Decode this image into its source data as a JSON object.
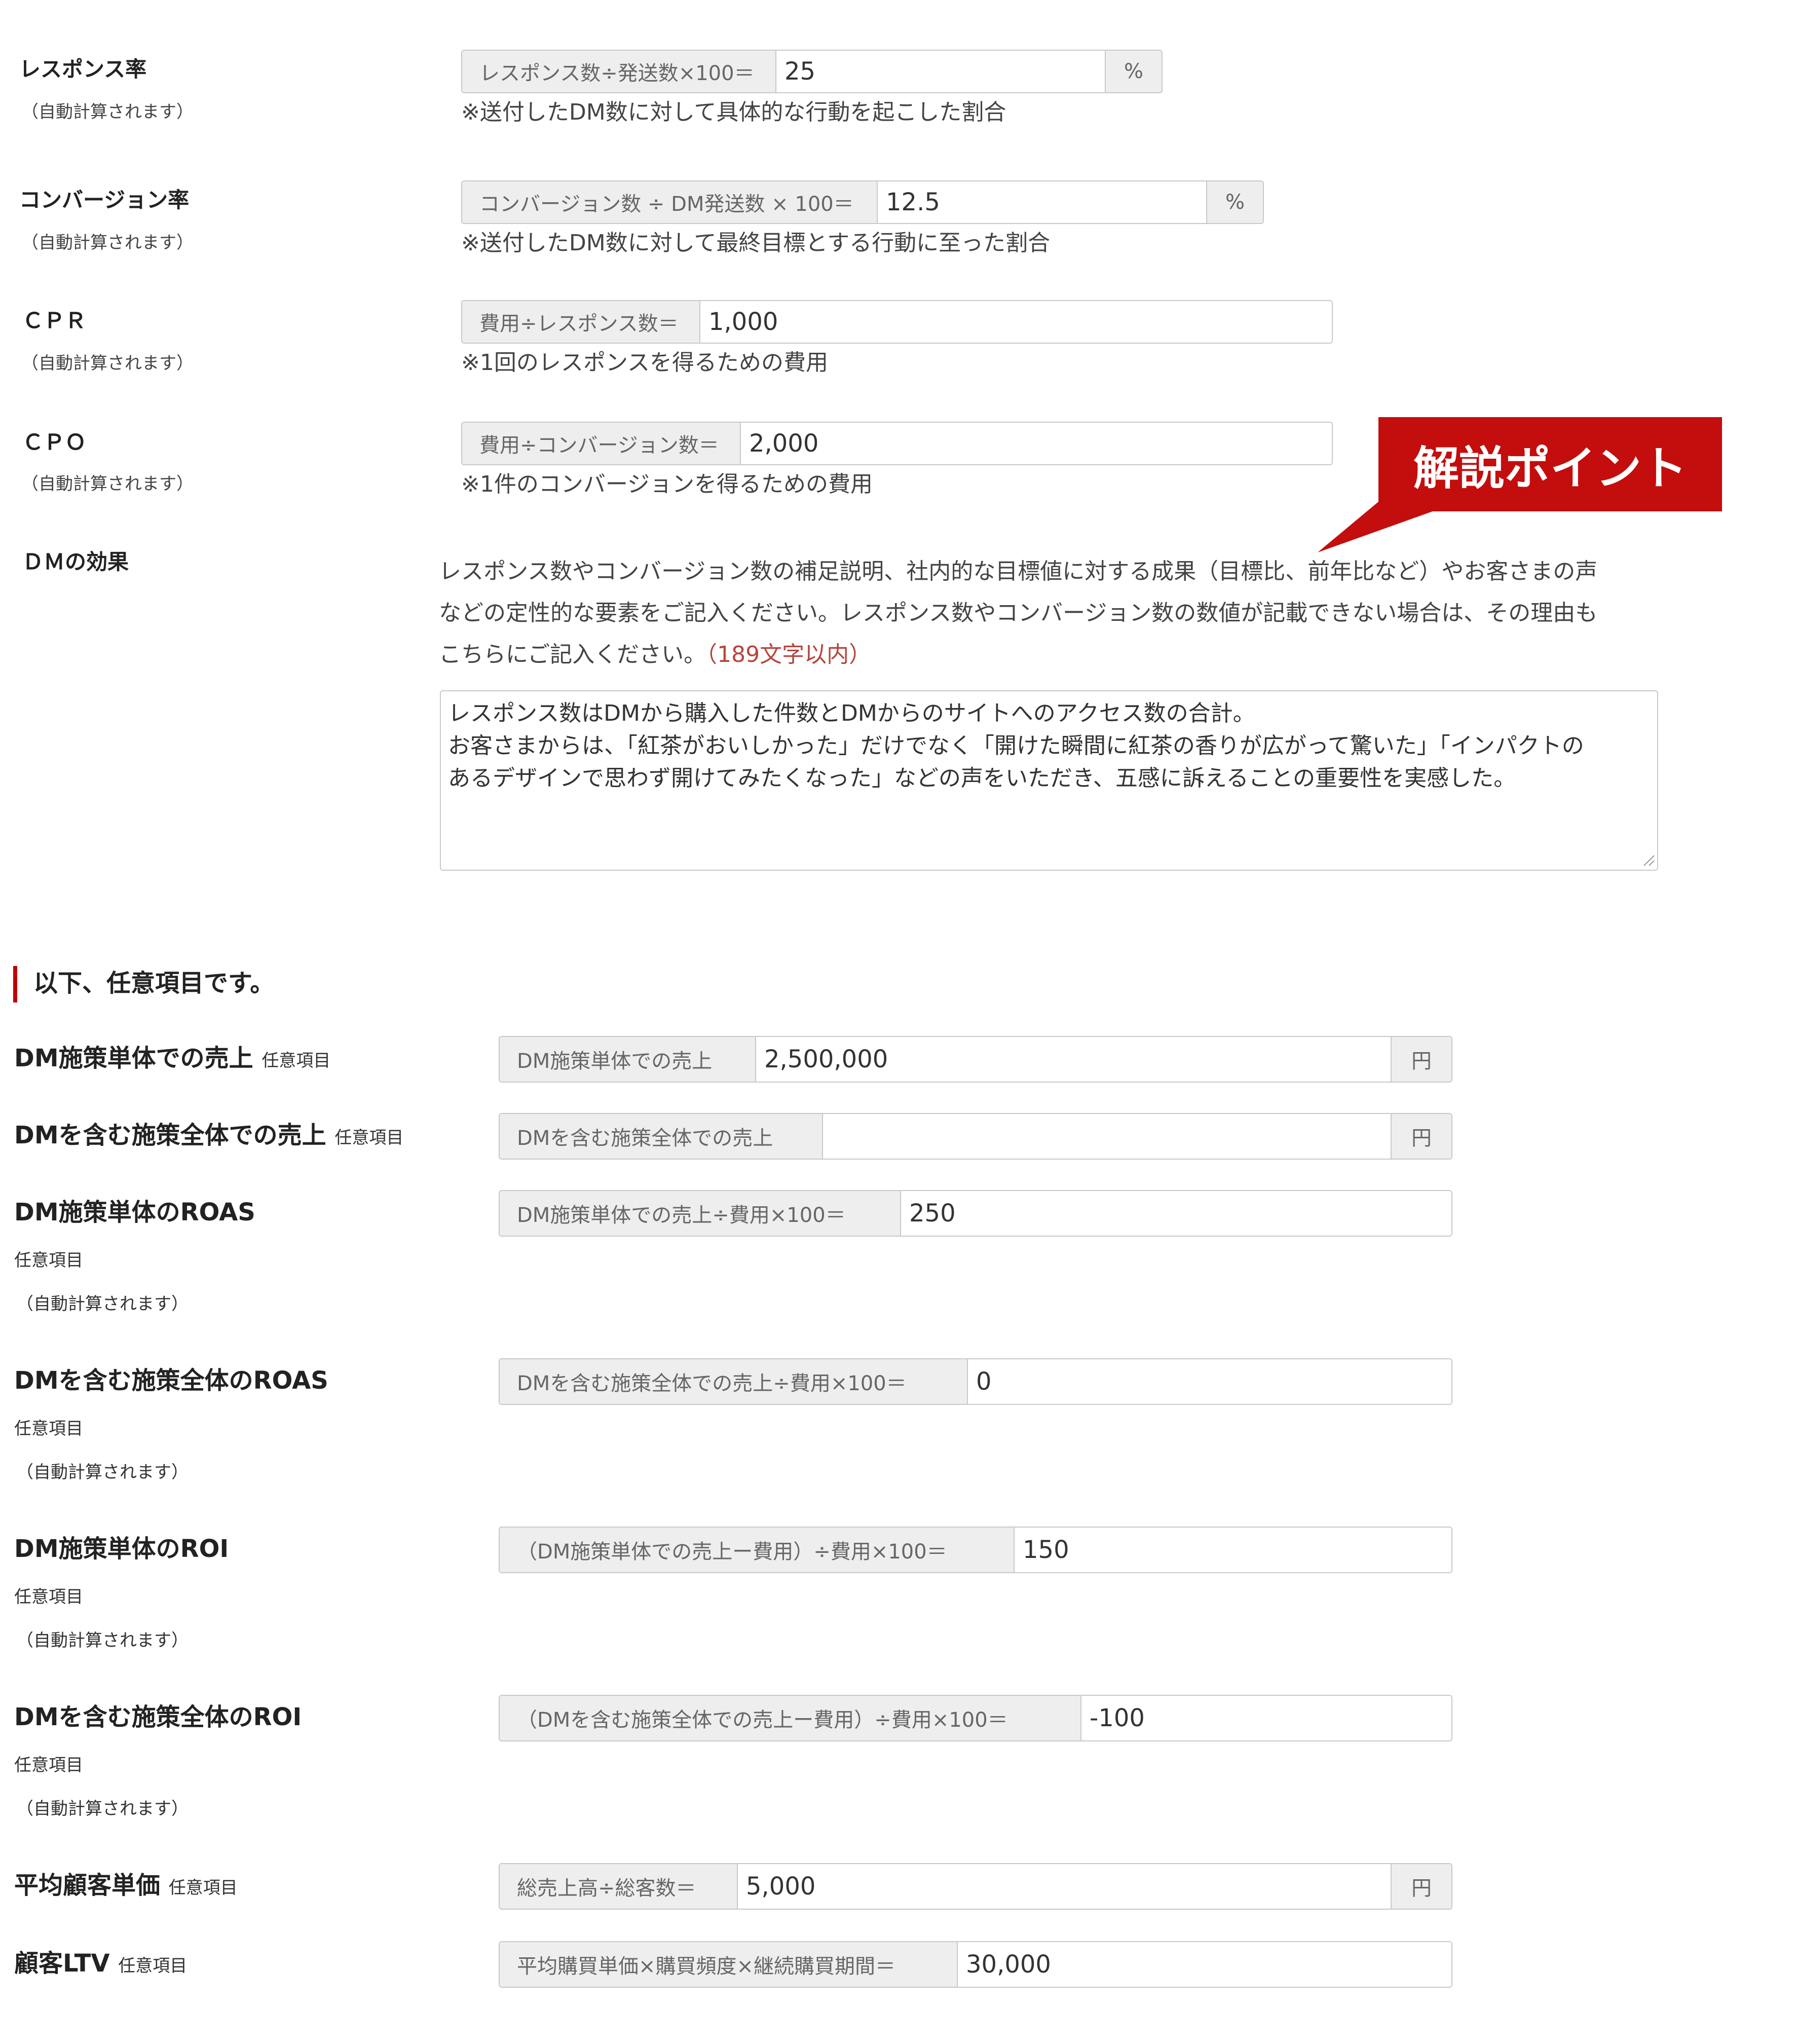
{
  "colors": {
    "accent_red": "#c40d0d",
    "section_bar": "#c00000",
    "limit_text": "#b5443c",
    "addon_bg": "#eeeeee",
    "border": "#c9c9c9"
  },
  "rows": {
    "response_rate": {
      "label": "レスポンス率",
      "note": "（自動計算されます）",
      "formula": "レスポンス数÷発送数×100＝",
      "value": "25",
      "unit": "%",
      "help": "※送付したDM数に対して具体的な行動を起こした割合"
    },
    "conversion_rate": {
      "label": "コンバージョン率",
      "note": "（自動計算されます）",
      "formula": "コンバージョン数 ÷ DM発送数 × 100＝",
      "value": "12.5",
      "unit": "%",
      "help": "※送付したDM数に対して最終目標とする行動に至った割合"
    },
    "cpr": {
      "label": "ＣＰＲ",
      "note": "（自動計算されます）",
      "formula": "費用÷レスポンス数＝",
      "value": "1,000",
      "help": "※1回のレスポンスを得るための費用"
    },
    "cpo": {
      "label": "ＣＰＯ",
      "note": "（自動計算されます）",
      "formula": "費用÷コンバージョン数＝",
      "value": "2,000",
      "help": "※1件のコンバージョンを得るための費用"
    }
  },
  "callout": {
    "text": "解説ポイント"
  },
  "dm_effect": {
    "label": "ＤＭの効果",
    "desc_line1": "レスポンス数やコンバージョン数の補足説明、社内的な目標値に対する成果（目標比、前年比など）やお客さまの声",
    "desc_line2": "などの定性的な要素をご記入ください。レスポンス数やコンバージョン数の数値が記載できない場合は、その理由も",
    "desc_line3": "こちらにご記入ください。",
    "limit": "（189文字以内）",
    "textarea_value": "レスポンス数はDMから購入した件数とDMからのサイトへのアクセス数の合計。\nお客さまからは、「紅茶がおいしかった」だけでなく「開けた瞬間に紅茶の香りが広がって驚いた」「インパクトの\nあるデザインで思わず開けてみたくなった」などの声をいただき、五感に訴えることの重要性を実感した。"
  },
  "section": {
    "title": "以下、任意項目です。"
  },
  "optional_tag": "任意項目",
  "auto_note": "（自動計算されます）",
  "optional": {
    "dm_sales": {
      "label": "DM施策単体での売上",
      "formula": "DM施策単体での売上",
      "value": "2,500,000",
      "unit": "円"
    },
    "total_sales": {
      "label": "DMを含む施策全体での売上",
      "formula": "DMを含む施策全体での売上",
      "value": "",
      "unit": "円"
    },
    "dm_roas": {
      "label": "DM施策単体のROAS",
      "formula": "DM施策単体での売上÷費用×100＝",
      "value": "250"
    },
    "total_roas": {
      "label": "DMを含む施策全体のROAS",
      "formula": "DMを含む施策全体での売上÷費用×100＝",
      "value": "0"
    },
    "dm_roi": {
      "label": "DM施策単体のROI",
      "formula": "（DM施策単体での売上ー費用）÷費用×100＝",
      "value": "150"
    },
    "total_roi": {
      "label": "DMを含む施策全体のROI",
      "formula": "（DMを含む施策全体での売上ー費用）÷費用×100＝",
      "value": "-100"
    },
    "avg_price": {
      "label": "平均顧客単価",
      "formula": "総売上高÷総客数＝",
      "value": "5,000",
      "unit": "円"
    },
    "ltv": {
      "label": "顧客LTV",
      "formula": "平均購買単価×購買頻度×継続購買期間＝",
      "value": "30,000"
    }
  }
}
